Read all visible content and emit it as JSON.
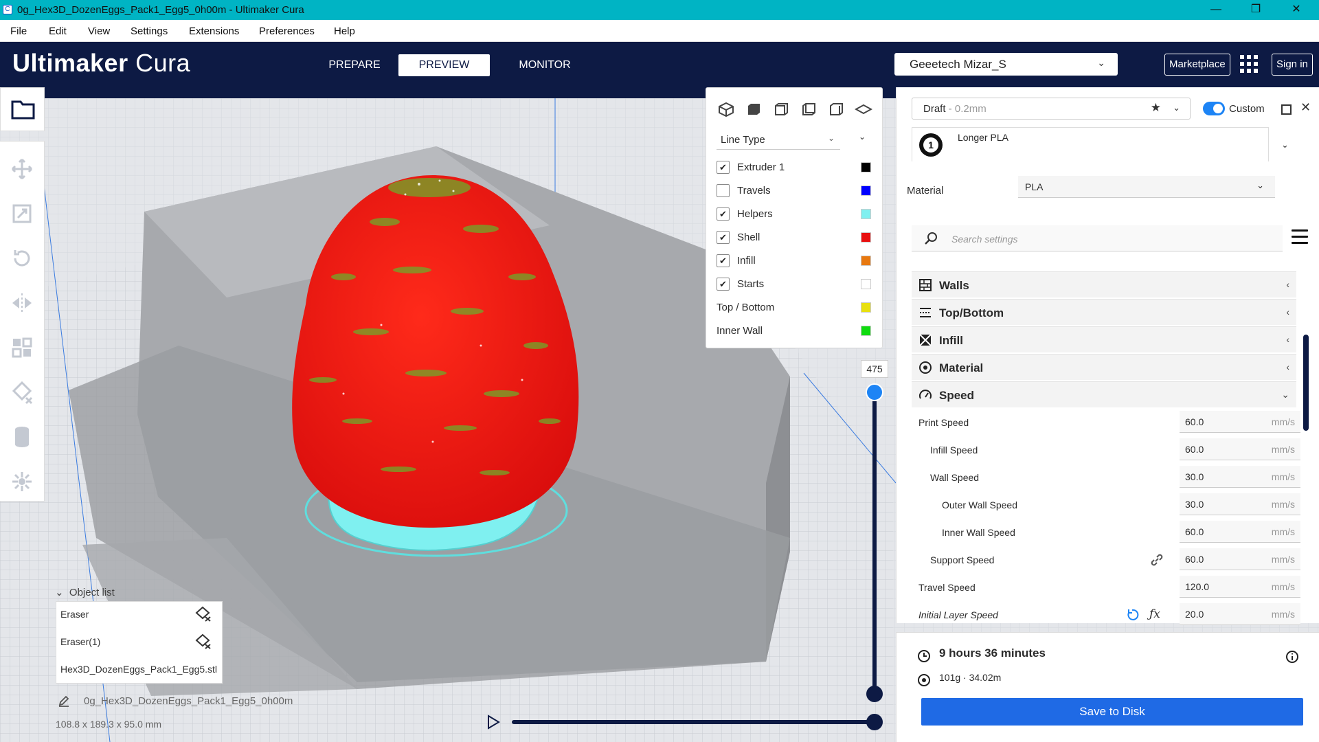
{
  "window": {
    "title": "0g_Hex3D_DozenEggs_Pack1_Egg5_0h00m - Ultimaker Cura",
    "minimize": "—",
    "maximize": "❐",
    "close": "✕"
  },
  "menu": [
    "File",
    "Edit",
    "View",
    "Settings",
    "Extensions",
    "Preferences",
    "Help"
  ],
  "header": {
    "logo_bold": "Ultimaker",
    "logo_thin": "Cura",
    "tabs": [
      "PREPARE",
      "PREVIEW",
      "MONITOR"
    ],
    "active_tab": "PREVIEW",
    "printer": "Geeetech Mizar_S",
    "marketplace": "Marketplace",
    "sign_in": "Sign in"
  },
  "view_panel": {
    "color_scheme": "Line Type",
    "legend": [
      {
        "label": "Extruder 1",
        "checkbox": true,
        "checked": true,
        "color": "#000000"
      },
      {
        "label": "Travels",
        "checkbox": true,
        "checked": false,
        "color": "#0000ff"
      },
      {
        "label": "Helpers",
        "checkbox": true,
        "checked": true,
        "color": "#7ff0f0"
      },
      {
        "label": "Shell",
        "checkbox": true,
        "checked": true,
        "color": "#e80f0f"
      },
      {
        "label": "Infill",
        "checkbox": true,
        "checked": true,
        "color": "#e8780f"
      },
      {
        "label": "Starts",
        "checkbox": true,
        "checked": true,
        "color": "#ffffff"
      },
      {
        "label": "Top / Bottom",
        "checkbox": false,
        "color": "#e8e00f"
      },
      {
        "label": "Inner Wall",
        "checkbox": false,
        "color": "#0fdc0f"
      }
    ]
  },
  "layer": {
    "current": "475"
  },
  "object_list": {
    "toggle": "Object list",
    "items": [
      "Eraser",
      "Eraser(1)",
      "Hex3D_DozenEggs_Pack1_Egg5.stl"
    ],
    "job_name": "0g_Hex3D_DozenEggs_Pack1_Egg5_0h00m",
    "dimensions": "108.8 x 189.3 x 95.0 mm"
  },
  "settings": {
    "profile": "Draft",
    "profile_sub": " - 0.2mm",
    "custom_label": "Custom",
    "extruder_name": "Longer PLA",
    "extruder_number": "1",
    "material_label": "Material",
    "material_value": "PLA",
    "search_placeholder": "Search settings",
    "categories": [
      {
        "name": "Walls",
        "expanded": false
      },
      {
        "name": "Top/Bottom",
        "expanded": false
      },
      {
        "name": "Infill",
        "expanded": false
      },
      {
        "name": "Material",
        "expanded": false
      },
      {
        "name": "Speed",
        "expanded": true
      }
    ],
    "speed_settings": [
      {
        "name": "Print Speed",
        "value": "60.0",
        "unit": "mm/s"
      },
      {
        "name": "Infill Speed",
        "value": "60.0",
        "unit": "mm/s"
      },
      {
        "name": "Wall Speed",
        "value": "30.0",
        "unit": "mm/s"
      },
      {
        "name": "Outer Wall Speed",
        "value": "30.0",
        "unit": "mm/s"
      },
      {
        "name": "Inner Wall Speed",
        "value": "60.0",
        "unit": "mm/s"
      },
      {
        "name": "Support Speed",
        "value": "60.0",
        "unit": "mm/s"
      },
      {
        "name": "Travel Speed",
        "value": "120.0",
        "unit": "mm/s"
      },
      {
        "name": "Initial Layer Speed",
        "value": "20.0",
        "unit": "mm/s"
      }
    ]
  },
  "summary": {
    "time": "9 hours 36 minutes",
    "material": "101g · 34.02m",
    "save_button": "Save to Disk"
  },
  "colors": {
    "header_bg": "#0d1a44",
    "titlebar_bg": "#00b4c4",
    "accent": "#1d84f5",
    "save_btn": "#1f6ae5",
    "shell": "#e80f0f",
    "helpers": "#7ff0f0"
  }
}
